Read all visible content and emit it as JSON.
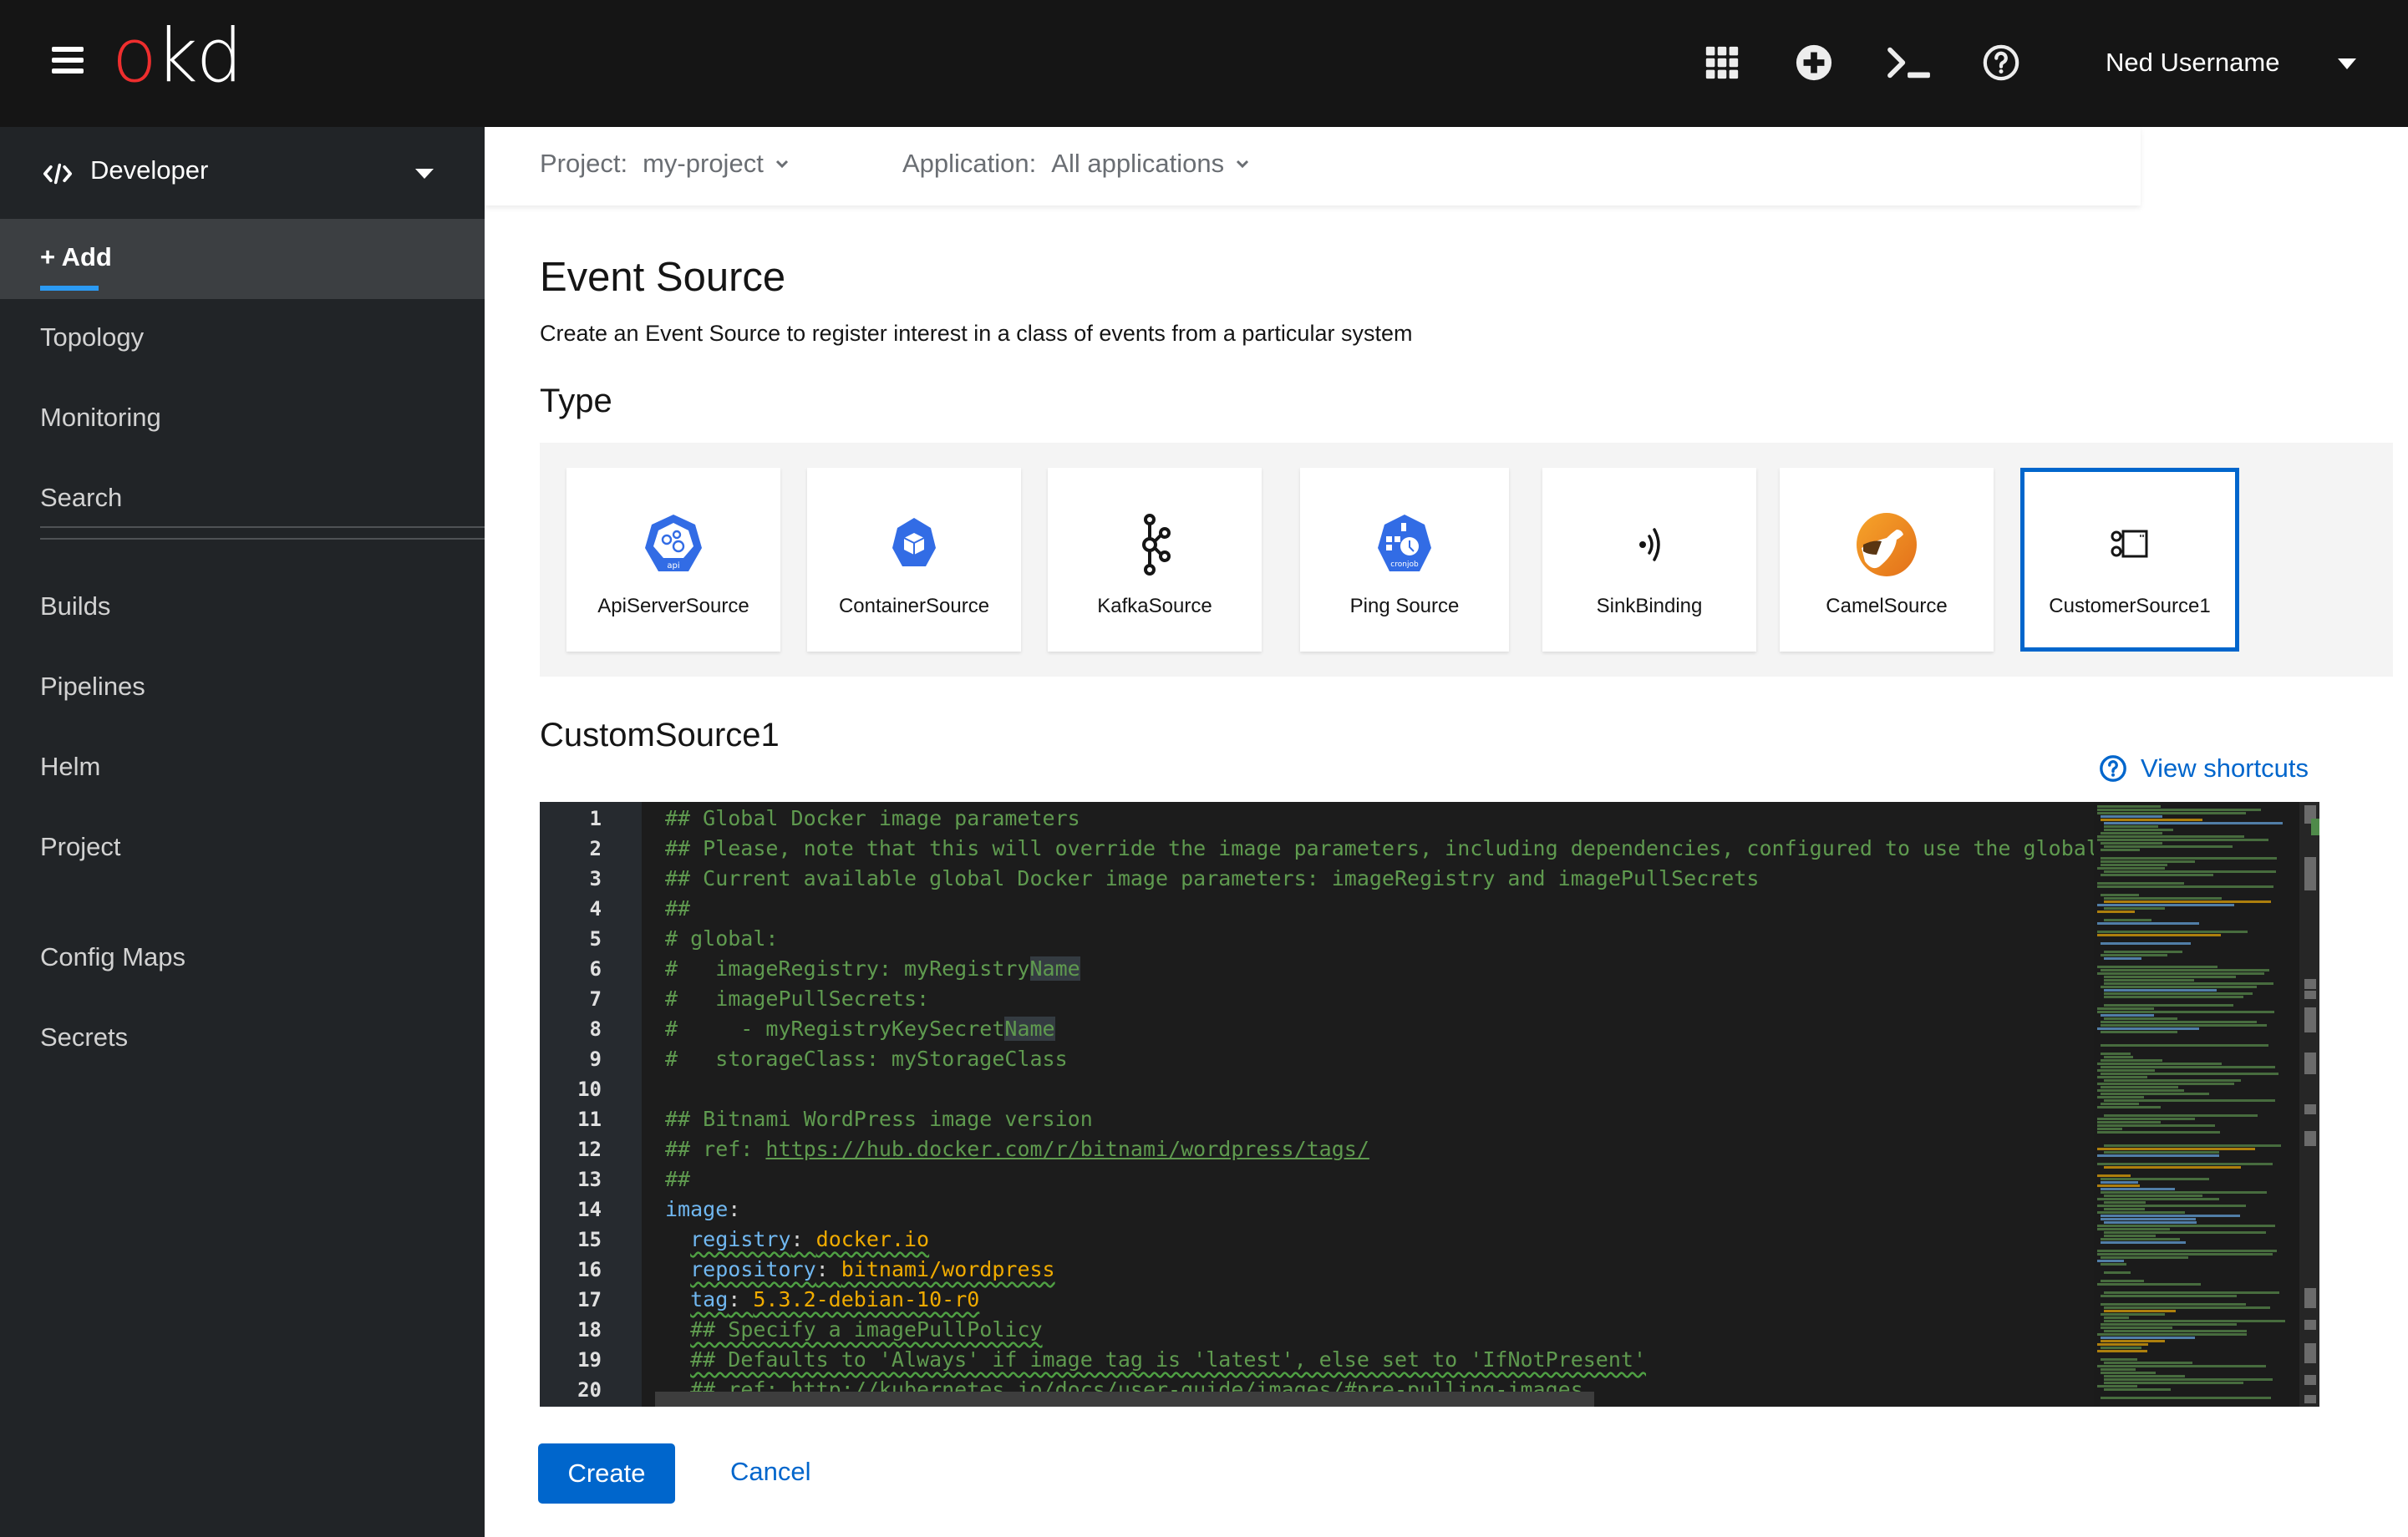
{
  "masthead": {
    "logo_o": "o",
    "logo_rest": "kd",
    "icons": [
      "app-launcher-icon",
      "import-yaml-plus-icon",
      "web-terminal-icon",
      "help-icon"
    ],
    "user_name": "Ned Username"
  },
  "sidebar": {
    "perspective": "Developer",
    "items": [
      {
        "label": "+ Add",
        "active": true
      },
      {
        "label": "Topology"
      },
      {
        "label": "Monitoring"
      },
      {
        "label": "Search"
      },
      {
        "label": "Builds"
      },
      {
        "label": "Pipelines"
      },
      {
        "label": "Helm"
      },
      {
        "label": "Project"
      },
      {
        "label": "Config Maps"
      },
      {
        "label": "Secrets"
      }
    ]
  },
  "context": {
    "project_label": "Project:",
    "project_value": "my-project",
    "application_label": "Application:",
    "application_value": "All applications"
  },
  "page": {
    "title": "Event Source",
    "description": "Create an Event Source to register interest in a class of events from a particular system",
    "type_heading": "Type",
    "selected_heading": "CustomSource1",
    "view_shortcuts": "View shortcuts"
  },
  "types": [
    {
      "label": "ApiServerSource",
      "icon": "api-server-source-icon",
      "icon_text": "api"
    },
    {
      "label": "ContainerSource",
      "icon": "container-source-icon"
    },
    {
      "label": "KafkaSource",
      "icon": "kafka-source-icon"
    },
    {
      "label": "Ping Source",
      "icon": "ping-source-cronjob-icon",
      "icon_text": "cronjob"
    },
    {
      "label": "SinkBinding",
      "icon": "sink-binding-icon"
    },
    {
      "label": "CamelSource",
      "icon": "camel-source-icon"
    },
    {
      "label": "CustomerSource1",
      "icon": "custom-source-icon",
      "selected": true
    }
  ],
  "editor": {
    "lines": [
      {
        "n": "1",
        "parts": [
          {
            "t": "## Global Docker image parameters",
            "c": "com"
          }
        ]
      },
      {
        "n": "2",
        "parts": [
          {
            "t": "## Please, note that this will override the image parameters, including dependencies, configured to use the global value",
            "c": "com"
          }
        ]
      },
      {
        "n": "3",
        "parts": [
          {
            "t": "## Current available global Docker image parameters: imageRegistry and imagePullSecrets",
            "c": "com"
          }
        ]
      },
      {
        "n": "4",
        "parts": [
          {
            "t": "##",
            "c": "com"
          }
        ]
      },
      {
        "n": "5",
        "parts": [
          {
            "t": "# global:",
            "c": "com"
          }
        ]
      },
      {
        "n": "6",
        "parts": [
          {
            "t": "#   imageRegistry: myRegistry",
            "c": "com"
          },
          {
            "t": "Name",
            "c": "com hl"
          }
        ]
      },
      {
        "n": "7",
        "parts": [
          {
            "t": "#   imagePullSecrets:",
            "c": "com"
          }
        ]
      },
      {
        "n": "8",
        "parts": [
          {
            "t": "#     - myRegistryKeySecret",
            "c": "com"
          },
          {
            "t": "Name",
            "c": "com hl"
          }
        ]
      },
      {
        "n": "9",
        "parts": [
          {
            "t": "#   storageClass: myStorageClass",
            "c": "com"
          }
        ]
      },
      {
        "n": "10",
        "parts": []
      },
      {
        "n": "11",
        "parts": [
          {
            "t": "## Bitnami WordPress image version",
            "c": "com"
          }
        ]
      },
      {
        "n": "12",
        "parts": [
          {
            "t": "## ref: ",
            "c": "com"
          },
          {
            "t": "https://hub.docker.com/r/bitnami/wordpress/tags/",
            "c": "com link"
          }
        ]
      },
      {
        "n": "13",
        "parts": [
          {
            "t": "##",
            "c": "com"
          }
        ]
      },
      {
        "n": "14",
        "parts": [
          {
            "t": "image",
            "c": "key"
          },
          {
            "t": ":",
            "c": "punc"
          }
        ]
      },
      {
        "n": "15",
        "parts": [
          {
            "t": "  ",
            "c": "punc"
          },
          {
            "t": "registry",
            "c": "key squig"
          },
          {
            "t": ": ",
            "c": "punc squig"
          },
          {
            "t": "docker.io",
            "c": "val squig"
          }
        ]
      },
      {
        "n": "16",
        "parts": [
          {
            "t": "  ",
            "c": "punc"
          },
          {
            "t": "repository",
            "c": "key squig"
          },
          {
            "t": ": ",
            "c": "punc squig"
          },
          {
            "t": "bitnami/wordpress",
            "c": "val squig"
          }
        ]
      },
      {
        "n": "17",
        "parts": [
          {
            "t": "  ",
            "c": "punc"
          },
          {
            "t": "tag",
            "c": "key squig"
          },
          {
            "t": ": ",
            "c": "punc squig"
          },
          {
            "t": "5.3.2-debian-10-r0",
            "c": "val squig"
          }
        ]
      },
      {
        "n": "18",
        "parts": [
          {
            "t": "  ",
            "c": "punc"
          },
          {
            "t": "## Specify a imagePullPolicy",
            "c": "com squig"
          }
        ]
      },
      {
        "n": "19",
        "parts": [
          {
            "t": "  ",
            "c": "punc"
          },
          {
            "t": "## Defaults to 'Always' if image tag is 'latest', else set to 'IfNotPresent'",
            "c": "com squig"
          }
        ]
      },
      {
        "n": "20",
        "parts": [
          {
            "t": "  ",
            "c": "punc"
          },
          {
            "t": "## ref: http://kubernetes.io/docs/user-guide/images/#pre-pulling-images",
            "c": "com squig"
          }
        ]
      }
    ]
  },
  "actions": {
    "create": "Create",
    "cancel": "Cancel"
  }
}
